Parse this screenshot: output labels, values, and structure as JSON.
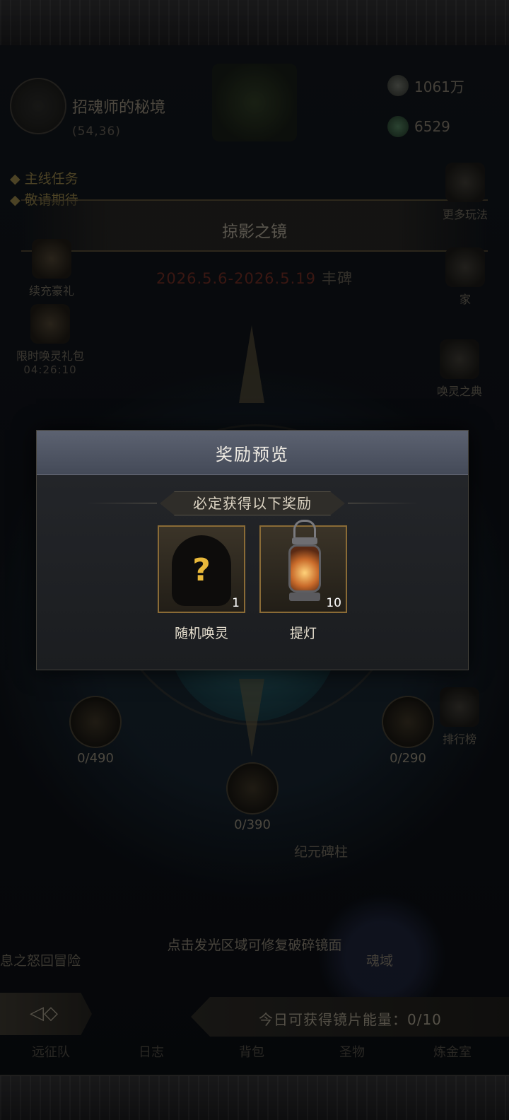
{
  "region": {
    "title": "招魂师的秘境",
    "coords": "(54,36)"
  },
  "resources": [
    {
      "value": "1061万",
      "icon": "stone-icon"
    },
    {
      "value": "6529",
      "icon": "leaf-gem-icon"
    }
  ],
  "quest": {
    "title": "主线任务",
    "subtitle": "敬请期待"
  },
  "event": {
    "title": "掠影之镜",
    "dates": "2026.5.6-2026.5.19",
    "tag": "丰碑"
  },
  "left_sidebar": [
    {
      "label": "续充豪礼"
    },
    {
      "label": "限时唤灵礼包",
      "timer": "04:26:10"
    }
  ],
  "right_sidebar": [
    {
      "label": "更多玩法"
    },
    {
      "label": "家"
    },
    {
      "label": "唤灵之典"
    },
    {
      "label": "排行榜"
    }
  ],
  "wheel": {
    "chests": [
      {
        "progress": "0/490"
      },
      {
        "progress": "0/290"
      },
      {
        "progress": "0/390"
      }
    ],
    "hint": "点击发光区域可修复破碎镜面",
    "plate_label": "纪元碑柱",
    "soul_label": "魂域",
    "left_bottom_label": "息之怒回冒险"
  },
  "bottom_bar": {
    "energy_text": "今日可获得镜片能量：0/10",
    "nav": [
      "远征队",
      "日志",
      "背包",
      "圣物",
      "炼金室"
    ]
  },
  "modal": {
    "title": "奖励预览",
    "subtitle": "必定获得以下奖励",
    "rewards": [
      {
        "name": "随机唤灵",
        "qty": "1",
        "icon": "mystery-silhouette-icon"
      },
      {
        "name": "提灯",
        "qty": "10",
        "icon": "lantern-icon"
      }
    ]
  },
  "colors": {
    "accent_gold": "#e8b83a",
    "event_date_red": "#6a2b22",
    "modal_header": "#555b69"
  }
}
